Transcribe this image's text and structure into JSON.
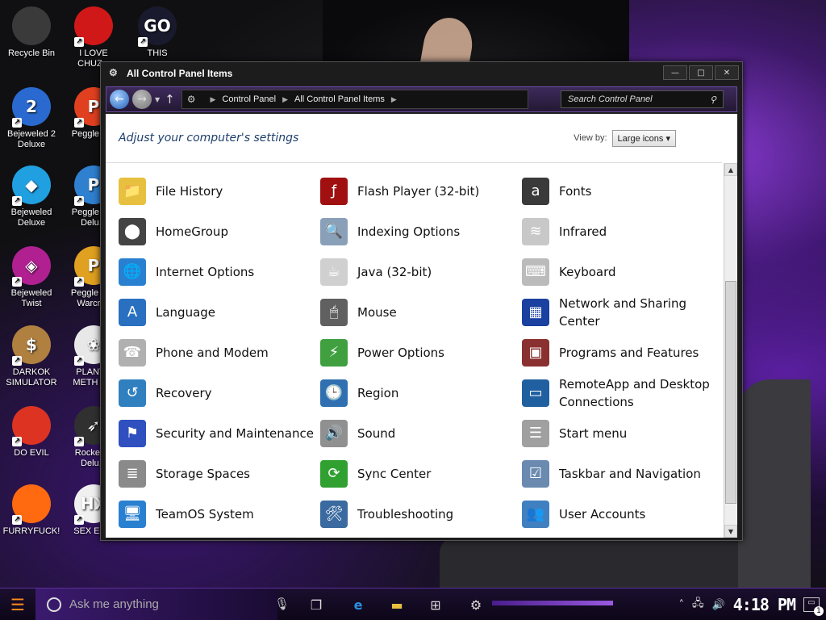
{
  "desktop": {
    "icons": [
      {
        "label": "Recycle Bin",
        "icon": "recycle-bin-icon",
        "color": "#3a3a3a"
      },
      {
        "label": "I LOVE CHUZ...",
        "icon": "red-creature-icon",
        "color": "#d01818"
      },
      {
        "label": "THIS",
        "icon": "goland-icon",
        "color": "#1a1a2e",
        "glyph": "GO"
      },
      {
        "label": "Bejeweled 2 Deluxe",
        "icon": "bejeweled-2-icon",
        "color": "#2a6ad0",
        "glyph": "2"
      },
      {
        "label": "Peggle D...",
        "icon": "peggle-icon",
        "color": "#e04020",
        "glyph": "P"
      },
      {
        "label": "Bejeweled Deluxe",
        "icon": "bejeweled-gem-icon",
        "color": "#20a0e0",
        "glyph": "◆"
      },
      {
        "label": "Peggle N... Delu...",
        "icon": "peggle-nights-icon",
        "color": "#3080d0",
        "glyph": "P"
      },
      {
        "label": "Bejeweled Twist",
        "icon": "bejeweled-twist-icon",
        "color": "#b02090",
        "glyph": "◈"
      },
      {
        "label": "Peggle W... Warcraft",
        "icon": "peggle-warcraft-icon",
        "color": "#e0a020",
        "glyph": "P"
      },
      {
        "label": "DARKOK SIMULATOR",
        "icon": "money-bag-icon",
        "color": "#b08040",
        "glyph": "$"
      },
      {
        "label": "PLANT... METH U...",
        "icon": "plant-icon",
        "color": "#e8e8e8",
        "glyph": "❀"
      },
      {
        "label": "DO EVIL",
        "icon": "chrome-icon",
        "color": "#dd3322"
      },
      {
        "label": "Rocket ... Delu...",
        "icon": "rocket-icon",
        "color": "#303030",
        "glyph": "➶"
      },
      {
        "label": "FURRYFUCK!",
        "icon": "firefox-icon",
        "color": "#ff6a10"
      },
      {
        "label": "SEX ED...",
        "icon": "hex-icon",
        "color": "#f0f0f0",
        "glyph": "HX"
      }
    ]
  },
  "window": {
    "title": "All Control Panel Items",
    "buttons": {
      "minimize": "—",
      "maximize": "□",
      "close": "✕"
    },
    "breadcrumb": [
      "Control Panel",
      "All Control Panel Items"
    ],
    "search_placeholder": "Search Control Panel",
    "page_title": "Adjust your computer's settings",
    "view_by_label": "View by:",
    "view_by_value": "Large icons ▾",
    "items": [
      {
        "label": "File History",
        "icon": "file-history-icon",
        "color": "#e8c040",
        "glyph": "📁"
      },
      {
        "label": "Flash Player (32-bit)",
        "icon": "flash-player-icon",
        "color": "#a01010",
        "glyph": "ƒ"
      },
      {
        "label": "Fonts",
        "icon": "fonts-icon",
        "color": "#3a3a3a",
        "glyph": "a"
      },
      {
        "label": "HomeGroup",
        "icon": "homegroup-icon",
        "color": "#444444",
        "glyph": "⬤"
      },
      {
        "label": "Indexing Options",
        "icon": "indexing-options-icon",
        "color": "#8aa0b8",
        "glyph": "🔍"
      },
      {
        "label": "Infrared",
        "icon": "infrared-icon",
        "color": "#c8c8c8",
        "glyph": "≋"
      },
      {
        "label": "Internet Options",
        "icon": "internet-options-icon",
        "color": "#2a80d0",
        "glyph": "🌐"
      },
      {
        "label": "Java (32-bit)",
        "icon": "java-icon",
        "color": "#d0d0d0",
        "glyph": "☕"
      },
      {
        "label": "Keyboard",
        "icon": "keyboard-icon",
        "color": "#bbbbbb",
        "glyph": "⌨"
      },
      {
        "label": "Language",
        "icon": "language-icon",
        "color": "#2a70c0",
        "glyph": "A"
      },
      {
        "label": "Mouse",
        "icon": "mouse-icon",
        "color": "#606060",
        "glyph": "🖱"
      },
      {
        "label": "Network and Sharing Center",
        "icon": "network-icon",
        "color": "#1a40a0",
        "glyph": "▦"
      },
      {
        "label": "Phone and Modem",
        "icon": "phone-modem-icon",
        "color": "#b0b0b0",
        "glyph": "☎"
      },
      {
        "label": "Power Options",
        "icon": "power-options-icon",
        "color": "#40a040",
        "glyph": "⚡"
      },
      {
        "label": "Programs and Features",
        "icon": "programs-features-icon",
        "color": "#8a3030",
        "glyph": "▣"
      },
      {
        "label": "Recovery",
        "icon": "recovery-icon",
        "color": "#3080c0",
        "glyph": "↺"
      },
      {
        "label": "Region",
        "icon": "region-icon",
        "color": "#3070b0",
        "glyph": "🕒"
      },
      {
        "label": "RemoteApp and Desktop Connections",
        "icon": "remoteapp-icon",
        "color": "#2060a0",
        "glyph": "▭"
      },
      {
        "label": "Security and Maintenance",
        "icon": "security-flag-icon",
        "color": "#3050c0",
        "glyph": "⚑"
      },
      {
        "label": "Sound",
        "icon": "sound-icon",
        "color": "#909090",
        "glyph": "🔊"
      },
      {
        "label": "Start menu",
        "icon": "start-menu-icon",
        "color": "#a0a0a0",
        "glyph": "☰"
      },
      {
        "label": "Storage Spaces",
        "icon": "storage-spaces-icon",
        "color": "#8a8a8a",
        "glyph": "≣"
      },
      {
        "label": "Sync Center",
        "icon": "sync-center-icon",
        "color": "#30a030",
        "glyph": "⟳"
      },
      {
        "label": "Taskbar and Navigation",
        "icon": "taskbar-nav-icon",
        "color": "#6a8ab0",
        "glyph": "☑"
      },
      {
        "label": "TeamOS System",
        "icon": "teamos-system-icon",
        "color": "#2a80d0",
        "glyph": "🖥"
      },
      {
        "label": "Troubleshooting",
        "icon": "troubleshooting-icon",
        "color": "#3a6aa0",
        "glyph": "🛠"
      },
      {
        "label": "User Accounts",
        "icon": "user-accounts-icon",
        "color": "#4080c0",
        "glyph": "👥"
      }
    ]
  },
  "taskbar": {
    "search_placeholder": "Ask me anything",
    "clock": "4:18 PM",
    "notification_count": "1"
  }
}
